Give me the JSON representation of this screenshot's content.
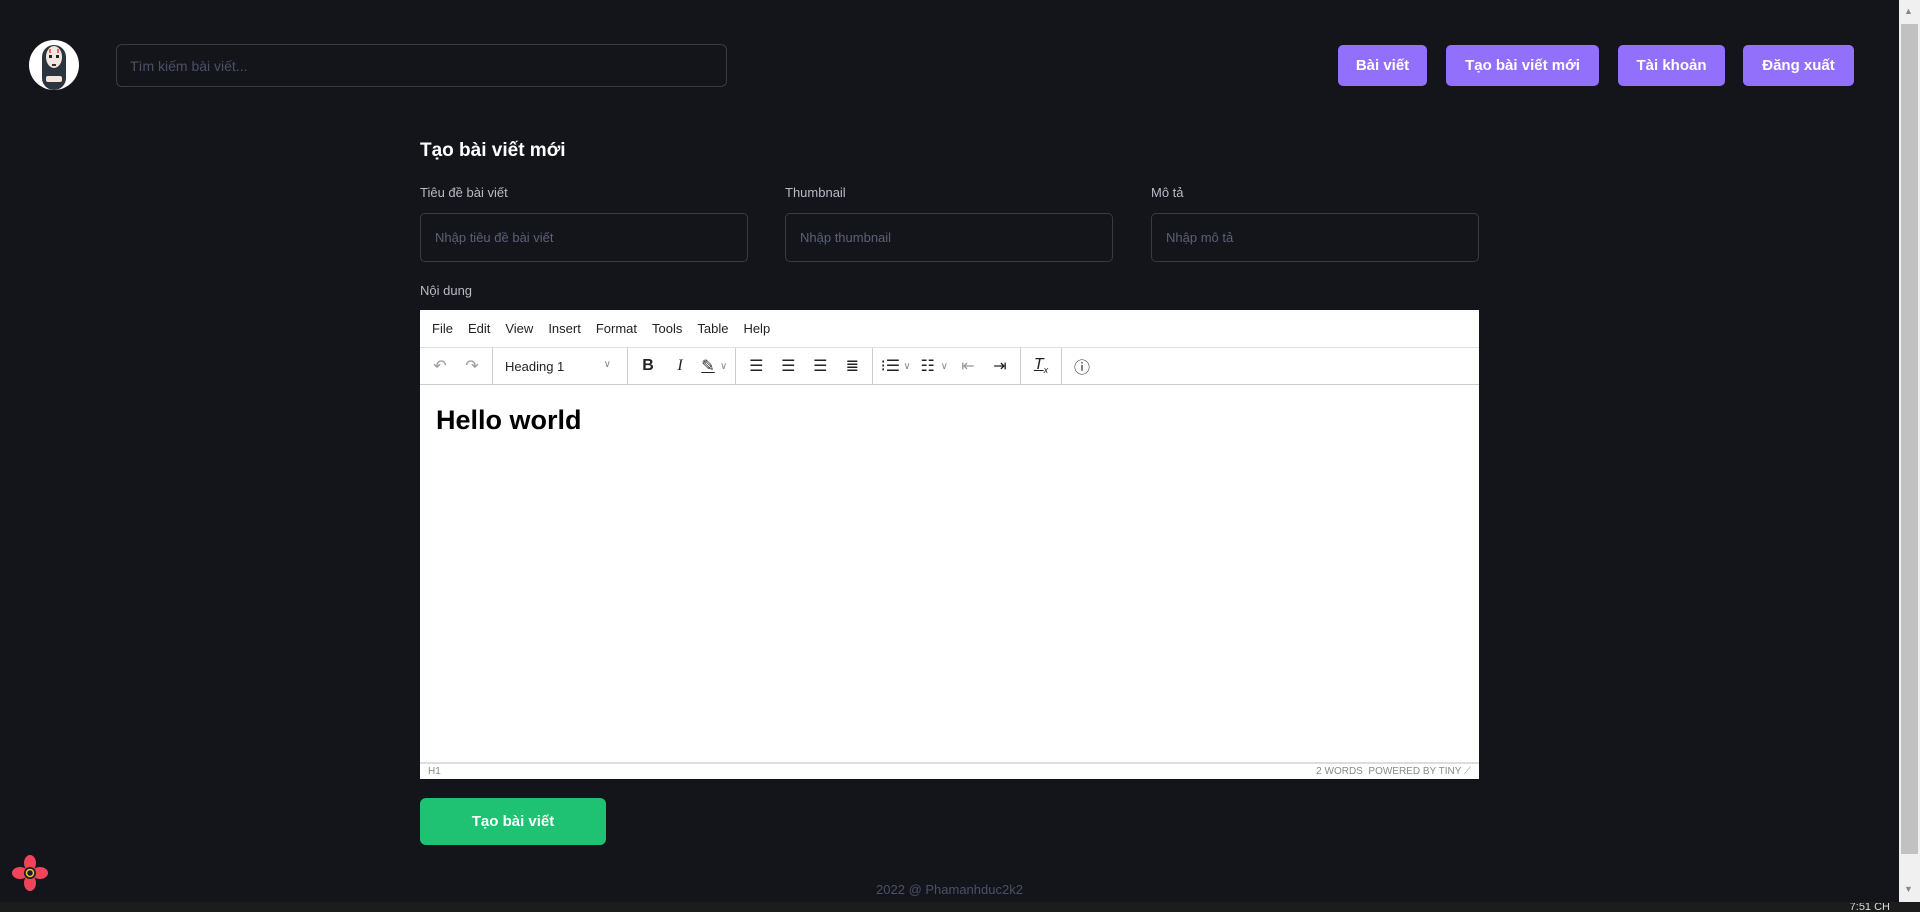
{
  "header": {
    "search_placeholder": "Tìm kiếm bài viết...",
    "nav": [
      "Bài viết",
      "Tạo bài viết mới",
      "Tài khoản",
      "Đăng xuất"
    ]
  },
  "form": {
    "title": "Tạo bài viết mới",
    "fields": [
      {
        "label": "Tiêu đề bài viết",
        "placeholder": "Nhập tiêu đề bài viết"
      },
      {
        "label": "Thumbnail",
        "placeholder": "Nhập thumbnail"
      },
      {
        "label": "Mô tả",
        "placeholder": "Nhập mô tả"
      }
    ],
    "content_label": "Nội dung",
    "submit_label": "Tạo bài viết"
  },
  "editor": {
    "menu": [
      "File",
      "Edit",
      "View",
      "Insert",
      "Format",
      "Tools",
      "Table",
      "Help"
    ],
    "block_format": "Heading 1",
    "content": "Hello world",
    "status_path": "H1",
    "word_count": "2 WORDS",
    "powered_by": "POWERED BY TINY"
  },
  "footer": {
    "text": "2022 @ Phamanhduc2k2"
  },
  "taskbar": {
    "clock": "7:51 CH"
  },
  "colors": {
    "accent": "#9370fb",
    "submit": "#1ec272",
    "background": "#14151a"
  }
}
